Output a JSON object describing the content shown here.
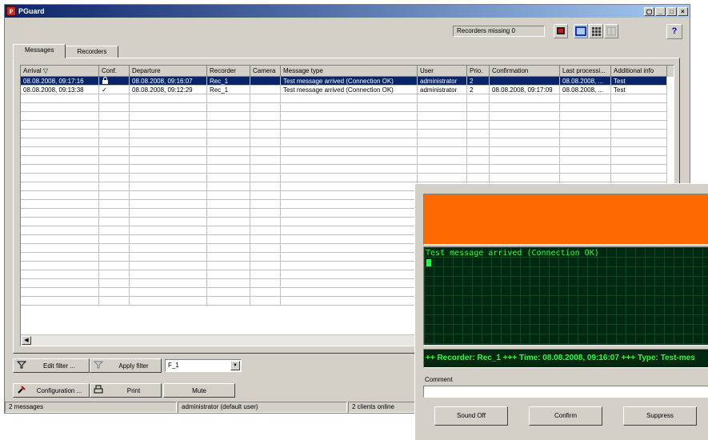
{
  "window": {
    "title": "PGuard",
    "controls": [
      "▢",
      "_",
      "□",
      "×"
    ]
  },
  "toolbar": {
    "recorders_missing": "Recorders missing 0",
    "help_label": "?"
  },
  "tabs": [
    {
      "label": "Messages"
    },
    {
      "label": "Recorders"
    }
  ],
  "grid": {
    "columns": [
      "Arrival  ▽",
      "Conf.",
      "Departure",
      "Recorder",
      "Camera",
      "Message type",
      "User",
      "Prio.",
      "Confirmation",
      "Last processi...",
      "Additional info"
    ],
    "rows": [
      [
        "08.08.2008, 09:17:16",
        "",
        "08.08.2008, 09:16:07",
        "Rec_1",
        "",
        "Test message arrived (Connection OK)",
        "administrator",
        "2",
        "",
        "08.08.2008, ...",
        "Test"
      ],
      [
        "08.08.2008, 09:13:38",
        "✓",
        "08.08.2008, 09:12:29",
        "Rec_1",
        "",
        "Test message arrived (Connection OK)",
        "administrator",
        "2",
        "08.08.2008, 09:17:09",
        "08.08.2008, ...",
        "Test"
      ]
    ],
    "empty_row_count": 24
  },
  "buttons": {
    "edit_filter": "Edit filter ...",
    "apply_filter": "Apply filter",
    "filter_value": "F_1",
    "configuration": "Configuration ...",
    "print": "Print",
    "mute": "Mute"
  },
  "status": {
    "messages": "2 messages",
    "user": "administrator (default user)",
    "clients": "2 clients online"
  },
  "alarm": {
    "message": "Test message arrived (Connection OK)",
    "ticker": "++  Recorder: Rec_1 +++ Time: 08.08.2008, 09:16:07 +++ Type: Test-mes",
    "comment_label": "Comment",
    "comment_value": "",
    "sound_off": "Sound Off",
    "confirm": "Confirm",
    "suppress": "Suppress"
  },
  "colors": {
    "alarm_orange": "#ff6a00",
    "selection": "#0a246a",
    "terminal_green": "#20ff40"
  }
}
